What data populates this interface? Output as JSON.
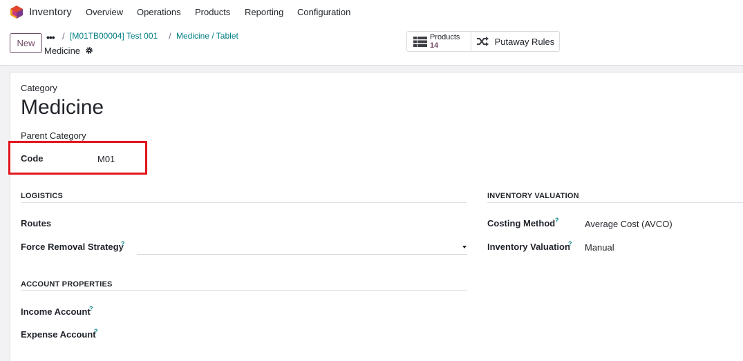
{
  "navbar": {
    "app_name": "Inventory",
    "menu": [
      "Overview",
      "Operations",
      "Products",
      "Reporting",
      "Configuration"
    ]
  },
  "control_panel": {
    "new_label": "New",
    "breadcrumb_dots": "•••",
    "breadcrumbs": [
      "[M01TB00004] Test 001",
      "Medicine / Tablet"
    ],
    "current": "Medicine",
    "smart_buttons": {
      "products_label": "Products",
      "products_count": "14",
      "putaway_label": "Putaway Rules"
    }
  },
  "form": {
    "category_label": "Category",
    "title": "Medicine",
    "parent_label": "Parent Category",
    "code_label": "Code",
    "code_value": "M01",
    "logistics": {
      "heading": "LOGISTICS",
      "routes_label": "Routes",
      "force_removal_label": "Force Removal Strategy",
      "force_removal_value": ""
    },
    "account_properties": {
      "heading": "ACCOUNT PROPERTIES",
      "income_label": "Income Account",
      "expense_label": "Expense Account"
    },
    "inventory_valuation": {
      "heading": "INVENTORY VALUATION",
      "costing_label": "Costing Method",
      "costing_value": "Average Cost (AVCO)",
      "valuation_label": "Inventory Valuation",
      "valuation_value": "Manual"
    },
    "help_mark": "?"
  },
  "colors": {
    "brand": "#714b67",
    "link": "#017e84",
    "highlight": "#e2141a"
  }
}
